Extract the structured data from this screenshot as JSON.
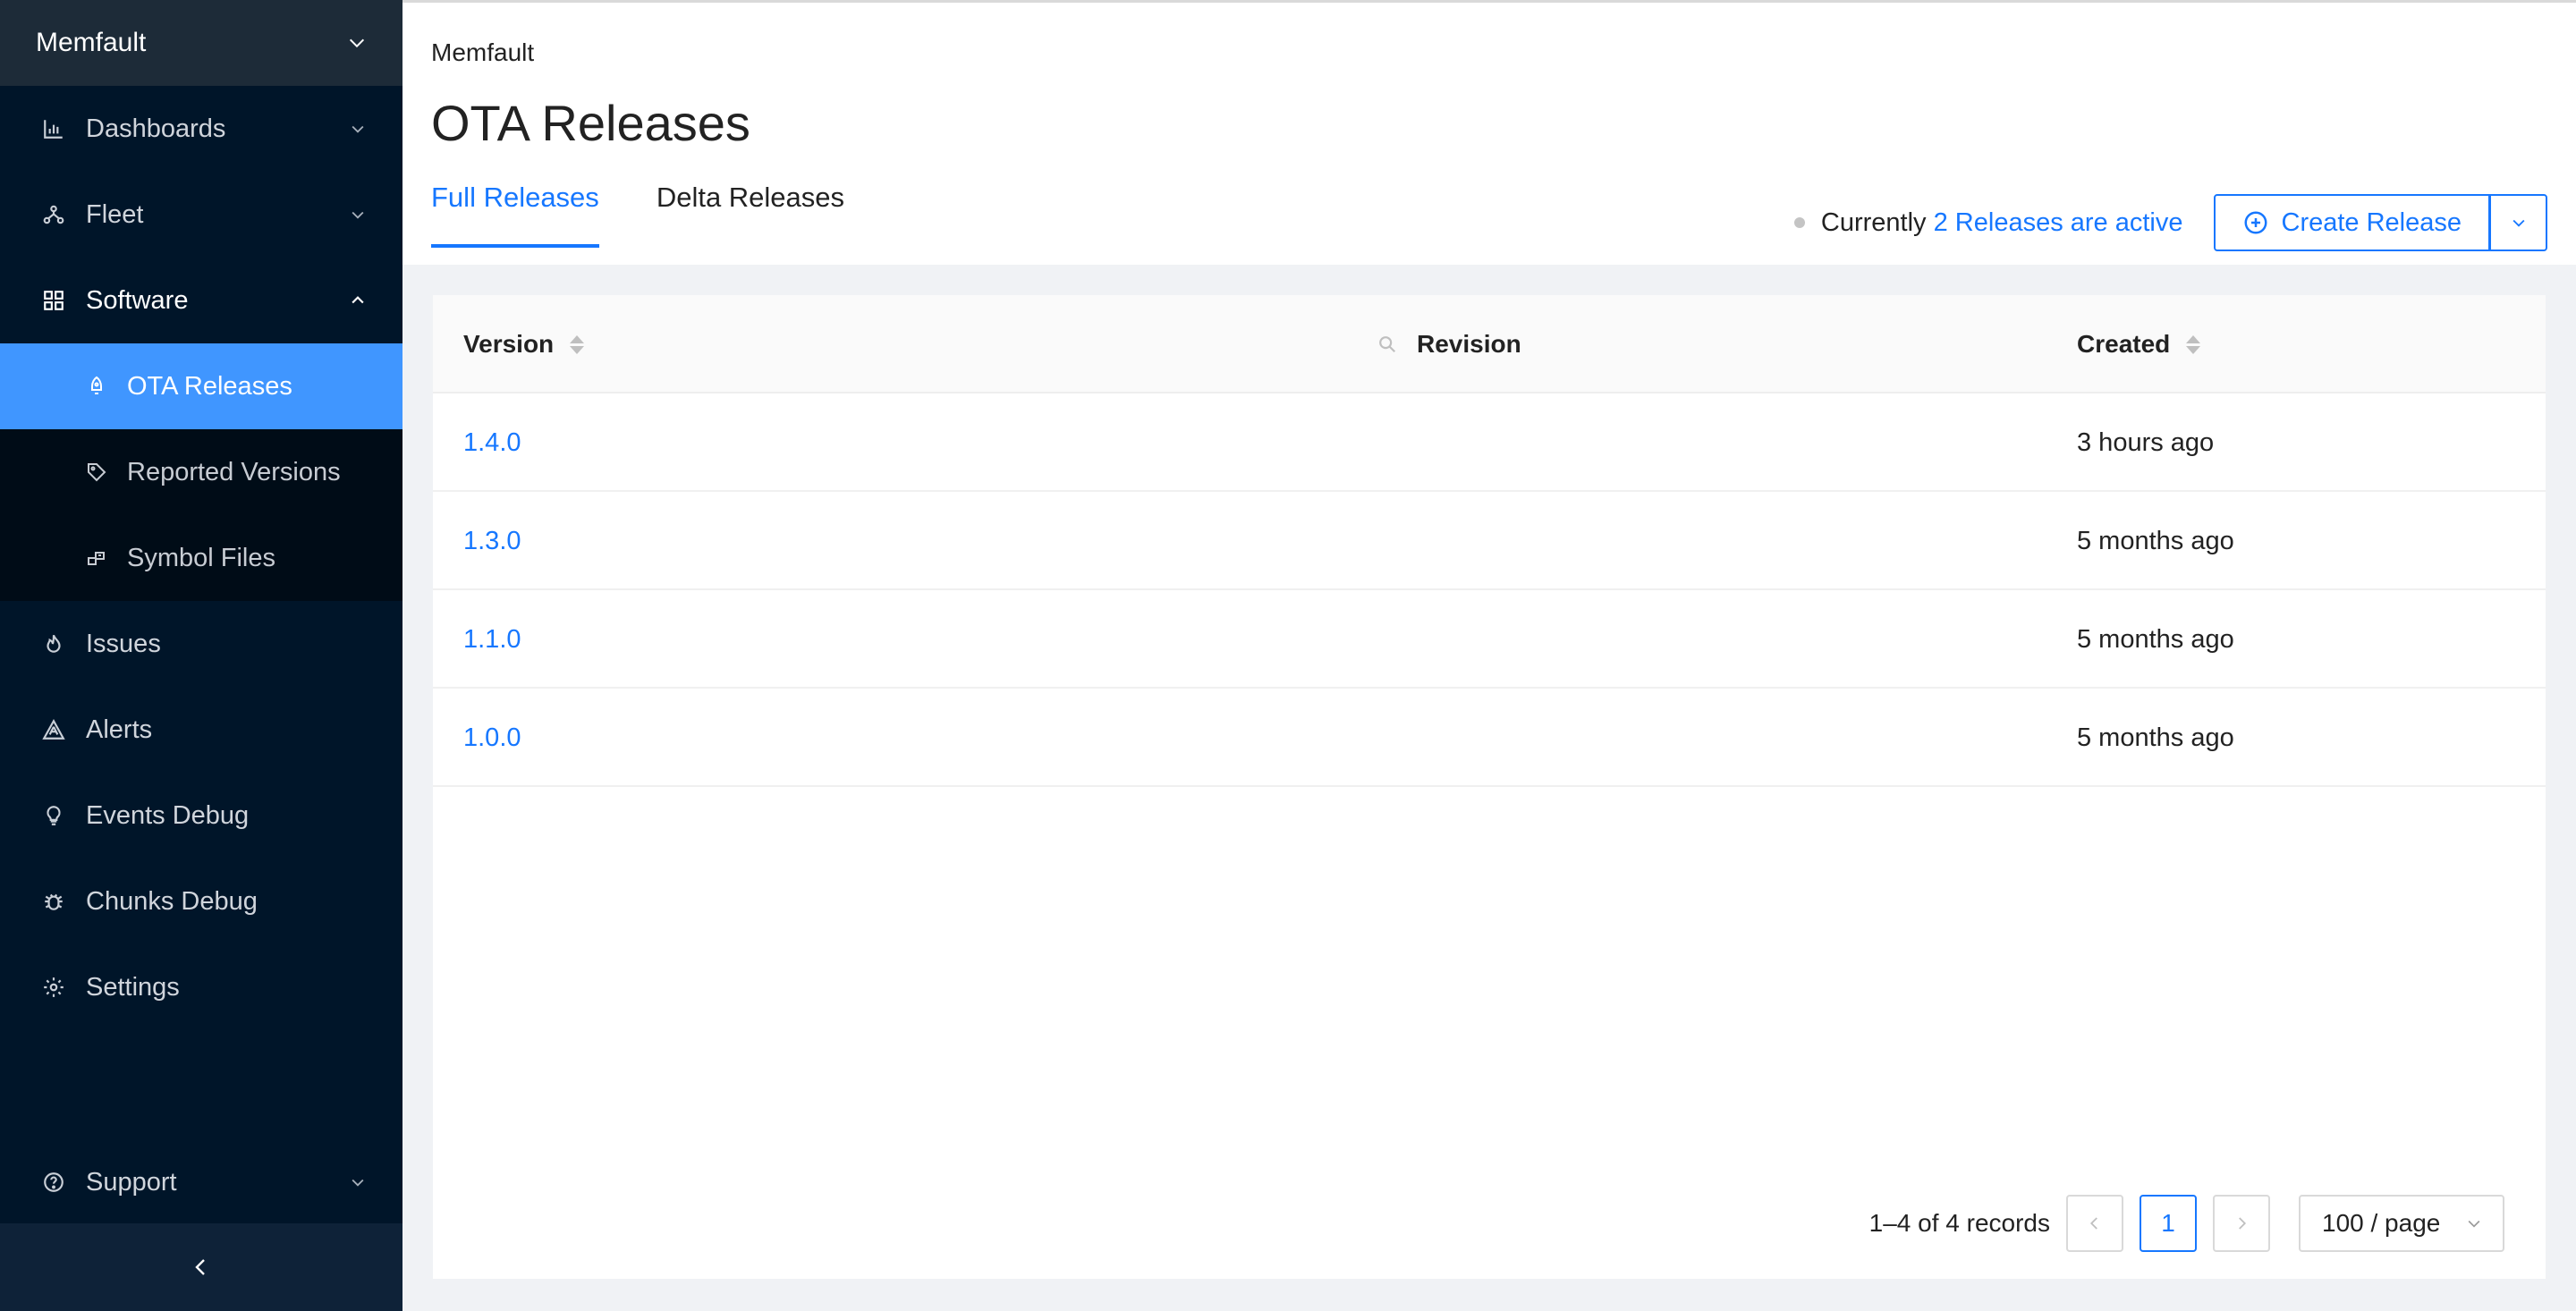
{
  "sidebar": {
    "org_name": "Memfault",
    "items": [
      {
        "label": "Dashboards",
        "icon": "bar-chart-icon"
      },
      {
        "label": "Fleet",
        "icon": "cluster-icon"
      },
      {
        "label": "Software",
        "icon": "appstore-icon"
      },
      {
        "label": "Issues",
        "icon": "fire-icon"
      },
      {
        "label": "Alerts",
        "icon": "alert-icon"
      },
      {
        "label": "Events Debug",
        "icon": "bulb-icon"
      },
      {
        "label": "Chunks Debug",
        "icon": "bug-icon"
      },
      {
        "label": "Settings",
        "icon": "gear-icon"
      }
    ],
    "software_submenu": [
      {
        "label": "OTA Releases",
        "icon": "rocket-icon",
        "active": true
      },
      {
        "label": "Reported Versions",
        "icon": "tag-icon",
        "active": false
      },
      {
        "label": "Symbol Files",
        "icon": "block-icon",
        "active": false
      }
    ],
    "support_label": "Support"
  },
  "header": {
    "breadcrumb": "Memfault",
    "title": "OTA Releases",
    "tabs": [
      {
        "label": "Full Releases",
        "active": true
      },
      {
        "label": "Delta Releases",
        "active": false
      }
    ],
    "status_prefix": "Currently",
    "status_link": "2 Releases are active",
    "create_button": "Create Release"
  },
  "table": {
    "columns": {
      "version": "Version",
      "revision": "Revision",
      "created": "Created"
    },
    "rows": [
      {
        "version": "1.4.0",
        "revision": "",
        "created": "3 hours ago"
      },
      {
        "version": "1.3.0",
        "revision": "",
        "created": "5 months ago"
      },
      {
        "version": "1.1.0",
        "revision": "",
        "created": "5 months ago"
      },
      {
        "version": "1.0.0",
        "revision": "",
        "created": "5 months ago"
      }
    ]
  },
  "pagination": {
    "total": "1–4 of 4 records",
    "current_page": "1",
    "page_size": "100 / page"
  },
  "colors": {
    "accent": "#1677ff",
    "sidebar_bg": "#001529",
    "active_item_bg": "#4096ff"
  }
}
